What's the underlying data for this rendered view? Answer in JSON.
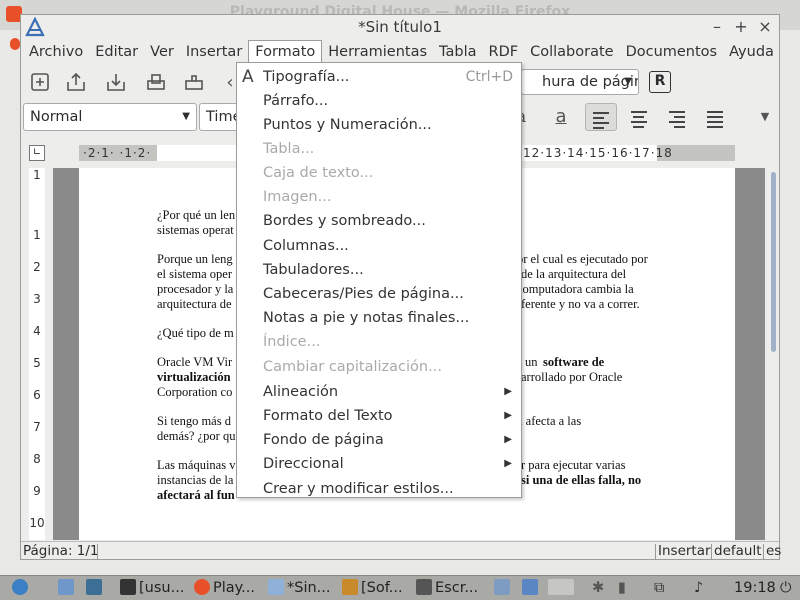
{
  "background_window": {
    "title": "Playground Digital House — Mozilla Firefox"
  },
  "window": {
    "title": "*Sin título1",
    "minimize": "–",
    "maximize": "+",
    "close": "×"
  },
  "menubar": [
    "Archivo",
    "Editar",
    "Ver",
    "Insertar",
    "Formato",
    "Herramientas",
    "Tabla",
    "RDF",
    "Collaborate",
    "Documentos",
    "Ayuda"
  ],
  "toolbar": {
    "page_style": "hura de página",
    "r_button": "R"
  },
  "formatting": {
    "para_style": "Normal",
    "font_name": "Time"
  },
  "ruler": {
    "left_text": "·2·1· ·1·2·",
    "right_text": "12·13·14·15·16·17·18"
  },
  "vruler": [
    "1",
    "1",
    "2",
    "3",
    "4",
    "5",
    "6",
    "7",
    "8",
    "9",
    "10"
  ],
  "document": {
    "lines": [
      [
        "¿Por qué un len",
        "nos"
      ],
      [
        "sistemas operat"
      ],
      [
        "Porque un leng",
        "or el cual es ejecutado por"
      ],
      [
        "el sistema oper",
        "de la arquitectura del"
      ],
      [
        "procesador y la",
        " computadora cambia la"
      ],
      [
        "arquitectura de",
        "ferente y no va a correr."
      ],
      [
        "¿Qué tipo de m"
      ],
      [
        "Oracle VM Vir",
        "s un ",
        "software de"
      ],
      [
        "virtualización",
        "arrollado por Oracle"
      ],
      [
        "Corporation co"
      ],
      [
        "Si tengo más d",
        "a afecta a las"
      ],
      [
        "demás? ¿por qu"
      ],
      [
        "Las máquinas v",
        "r para ejecutar varias"
      ],
      [
        "instancias de la",
        "si una de ellas falla, no"
      ],
      [
        "afectará al fun"
      ]
    ]
  },
  "format_menu": {
    "items": [
      {
        "label": "Tipografía...",
        "shortcut": "Ctrl+D",
        "enabled": true
      },
      {
        "label": "Párrafo...",
        "enabled": true
      },
      {
        "label": "Puntos y Numeración...",
        "enabled": true
      },
      {
        "label": "Tabla...",
        "enabled": false
      },
      {
        "label": "Caja de texto...",
        "enabled": false
      },
      {
        "label": "Imagen...",
        "enabled": false
      },
      {
        "label": "Bordes y sombreado...",
        "enabled": true
      },
      {
        "label": "Columnas...",
        "enabled": true
      },
      {
        "label": "Tabuladores...",
        "enabled": true
      },
      {
        "label": "Cabeceras/Pies de página...",
        "enabled": true
      },
      {
        "label": "Notas a pie y notas finales...",
        "enabled": true
      },
      {
        "label": "Índice...",
        "enabled": false
      },
      {
        "label": "Cambiar capitalización...",
        "enabled": false
      },
      {
        "label": "Alineación",
        "submenu": true,
        "enabled": true
      },
      {
        "label": "Formato del Texto",
        "submenu": true,
        "enabled": true
      },
      {
        "label": "Fondo de página",
        "submenu": true,
        "enabled": true
      },
      {
        "label": "Direccional",
        "submenu": true,
        "enabled": true
      },
      {
        "label": "Crear y modificar estilos...",
        "enabled": true
      }
    ]
  },
  "statusbar": {
    "page": "Página: 1/1",
    "mode": "Insertar",
    "lang": "default",
    "extra": "es"
  },
  "taskbar": {
    "items": [
      "[usu...",
      "Play...",
      "*Sin...",
      "[Sof...",
      "Escr..."
    ],
    "clock": "19:18"
  }
}
